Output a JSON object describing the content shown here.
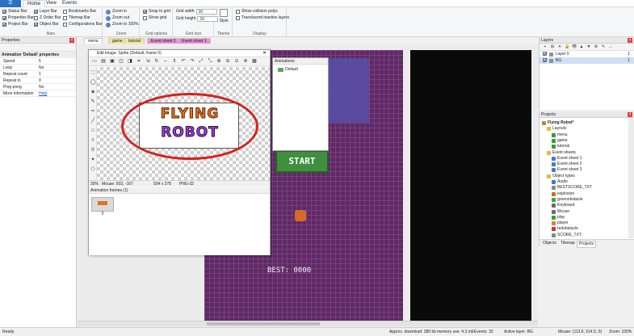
{
  "tabs": {
    "app_button": "☰",
    "home": "Home",
    "view": "View",
    "events": "Events"
  },
  "ribbon": {
    "bars": {
      "status_bar": "Status Bar",
      "properties_bar": "Properties Bar",
      "project_bar": "Project Bar",
      "layer_bar": "Layer Bar",
      "z_order_bar": "Z Order Bar",
      "object_bar": "Object Bar",
      "bookmarks_bar": "Bookmarks Bar",
      "tilemap_bar": "Tilemap Bar",
      "configurations_bar": "Configurations Bar",
      "group_label": "Bars"
    },
    "zoom": {
      "zoom_in": "Zoom in",
      "zoom_out": "Zoom out",
      "zoom_100": "Zoom to 100%",
      "group_label": "Zoom"
    },
    "grid_options": {
      "snap_to_grid": "Snap to grid",
      "show_grid": "Show grid",
      "group_label": "Grid options"
    },
    "grid_size": {
      "grid_width_label": "Grid width",
      "grid_width_value": "16",
      "grid_height_label": "Grid height",
      "grid_height_value": "16",
      "group_label": "Grid size"
    },
    "theme": {
      "style_label": "Style",
      "group_label": "Theme"
    },
    "display": {
      "show_collision": "Show collision polys",
      "translucent_layers": "Translucent inactive layers",
      "group_label": "Display"
    }
  },
  "properties": {
    "title": "Properties",
    "section": "Animation 'Default' properties",
    "rows": [
      {
        "key": "Speed",
        "value": "5"
      },
      {
        "key": "Loop",
        "value": "No"
      },
      {
        "key": "Repeat count",
        "value": "1"
      },
      {
        "key": "Repeat to",
        "value": "0"
      },
      {
        "key": "Ping-pong",
        "value": "No"
      },
      {
        "key": "More information",
        "value": "Help"
      }
    ]
  },
  "doc_tabs": {
    "menu": "menu",
    "game": "game",
    "tutorial": "tutorial",
    "event_sheet_2": "Event sheet 2",
    "event_sheet_1": "Event sheet 1"
  },
  "image_editor": {
    "title": "Edit image: Sprite (Default, frame 0)",
    "status_zoom": "30%",
    "status_mouse": "Mouse: 503, -167",
    "status_size": "504 x 278",
    "status_format": "PNG-32",
    "logo_line1": "FLYING",
    "logo_line2": "ROBOT"
  },
  "animations_panel": {
    "title": "Animations",
    "item": "Default"
  },
  "frames_panel": {
    "title": "Animation frames (1)",
    "frame_label": "0"
  },
  "game": {
    "start_label": "START",
    "best_label": "BEST: 0000"
  },
  "layers": {
    "title": "Layers",
    "items": [
      {
        "name": "Layer 0",
        "index": "1"
      },
      {
        "name": "BG",
        "index": "1"
      }
    ]
  },
  "projects": {
    "title": "Projects",
    "root": "Flying Robot*",
    "layouts_folder": "Layouts",
    "layouts": [
      "menu",
      "game",
      "tutorial"
    ],
    "event_sheets_folder": "Event sheets",
    "event_sheets": [
      "Event sheet 1",
      "Event sheet 2",
      "Event sheet 3"
    ],
    "object_types_folder": "Object types",
    "objects": [
      "Audio",
      "BESTSCORE_TXT",
      "explosion",
      "greenobstacle",
      "Keyboard",
      "Mouse",
      "play",
      "player",
      "redobstacle",
      "SCORE_TXT"
    ],
    "bottom_tabs": [
      "Objects",
      "Tilemap",
      "Projects"
    ]
  },
  "status": {
    "ready": "Ready",
    "download": "Approx. download: 380 kb",
    "memory": "memory use: 4.3 mb",
    "events": "Events: 32",
    "active_layer": "Active layer: BG",
    "mouse": "Mouse: (113.6, 514.5, 0)",
    "zoom": "Zoom: 100%"
  },
  "colors": {
    "accent": "#2b6fc7",
    "purple_bg": "#6a2a6e",
    "start_green": "#3f8f3f",
    "highlight_red": "#d62020"
  }
}
